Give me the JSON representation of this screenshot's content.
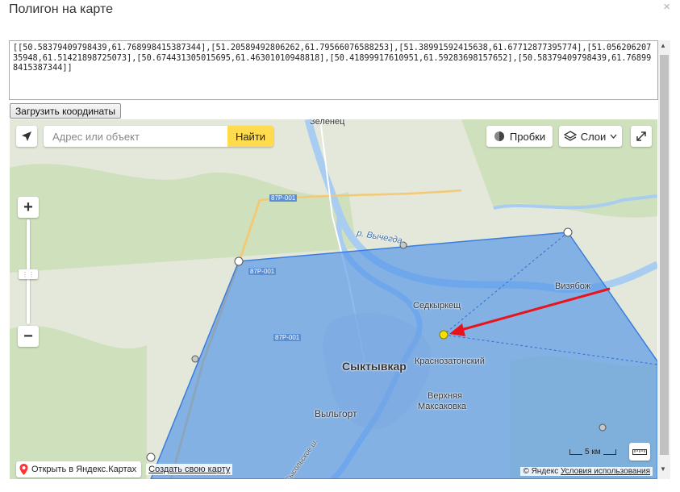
{
  "dialog": {
    "title": "Полигон на карте",
    "close_icon": "×"
  },
  "coordinates_text": "[[50.58379409798439,61.768998415387344],[51.20589492806262,61.79566076588253],[51.38991592415638,61.67712877395774],[51.05620620735948,61.51421898725073],[50.674431305015695,61.46301010948818],[50.41899917610951,61.59283698157652],[50.58379409798439,61.768998415387344]]",
  "load_button_label": "Загрузить координаты",
  "map": {
    "search_placeholder": "Адрес или объект",
    "find_label": "Найти",
    "traffic_label": "Пробки",
    "layers_label": "Слои",
    "open_in_yandex_label": "Открыть в Яндекс.Картах",
    "create_map_label": "Создать свою карту",
    "scale_label": "5 км",
    "copyright_text": "© Яндекс",
    "terms_link": "Условия использования",
    "labels": {
      "zelenets": "Зеленец",
      "river": "р. Вычегда",
      "vizyabozh": "Визябож",
      "sedkyrkesh": "Седкыркещ",
      "syktyvkar": "Сыктывкар",
      "krasnozatonsky": "Краснозатонский",
      "verkhnyaya": "Верхняя",
      "maksakovka": "Максаковка",
      "vylgort": "Выльгорт",
      "road_1": "87Р-001",
      "road_2": "87Р-001",
      "road_3": "87Р-001",
      "street": "Сысольское ш."
    },
    "colors": {
      "polygon_fill": "#4a8fe8",
      "polygon_stroke": "#3b7ddd",
      "arrow": "#e8131b",
      "marker": "#f5e100",
      "find_button": "#ffdb4d"
    }
  }
}
